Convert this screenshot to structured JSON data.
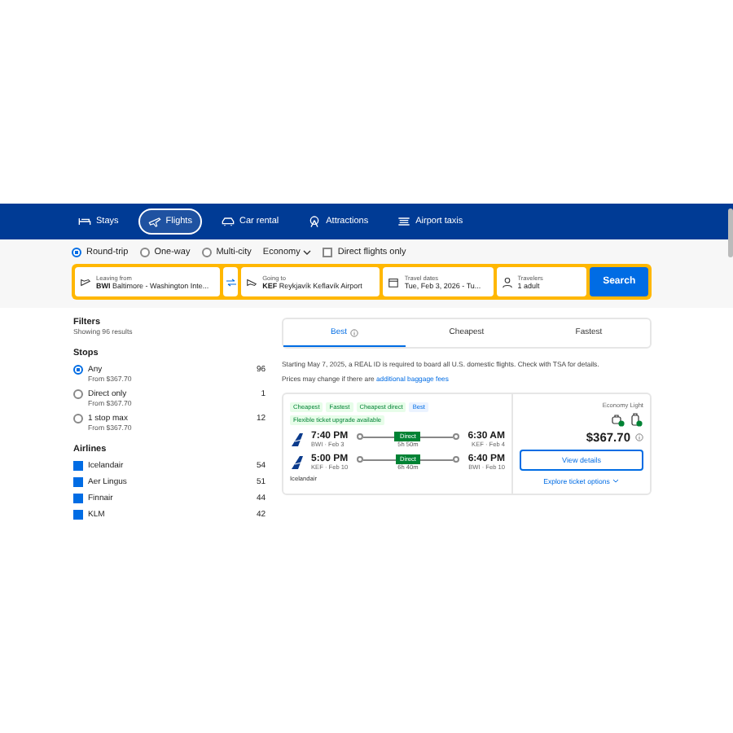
{
  "nav": [
    {
      "label": "Stays",
      "selected": false
    },
    {
      "label": "Flights",
      "selected": true
    },
    {
      "label": "Car rental",
      "selected": false
    },
    {
      "label": "Attractions",
      "selected": false
    },
    {
      "label": "Airport taxis",
      "selected": false
    }
  ],
  "trip_types": [
    {
      "label": "Round-trip",
      "selected": true
    },
    {
      "label": "One-way",
      "selected": false
    },
    {
      "label": "Multi-city",
      "selected": false
    }
  ],
  "cabin": "Economy",
  "direct_only": {
    "label": "Direct flights only",
    "checked": false
  },
  "search": {
    "from": {
      "label": "Leaving from",
      "code": "BWI",
      "value": "Baltimore - Washington Inte..."
    },
    "to": {
      "label": "Going to",
      "code": "KEF",
      "value": "Reykjavík Keflavík Airport"
    },
    "dates": {
      "label": "Travel dates",
      "value": "Tue, Feb 3, 2026 - Tu..."
    },
    "travelers": {
      "label": "Travelers",
      "value": "1 adult"
    },
    "button": "Search"
  },
  "filters": {
    "title": "Filters",
    "count": "Showing 96 results",
    "stops_title": "Stops",
    "stops": [
      {
        "label": "Any",
        "price": "From $367.70",
        "count": "96",
        "selected": true
      },
      {
        "label": "Direct only",
        "price": "From $367.70",
        "count": "1",
        "selected": false
      },
      {
        "label": "1 stop max",
        "price": "From $367.70",
        "count": "12",
        "selected": false
      }
    ],
    "airlines_title": "Airlines",
    "airlines": [
      {
        "label": "Icelandair",
        "count": "54",
        "checked": true
      },
      {
        "label": "Aer Lingus",
        "count": "51",
        "checked": true
      },
      {
        "label": "Finnair",
        "count": "44",
        "checked": true
      },
      {
        "label": "KLM",
        "count": "42",
        "checked": true
      }
    ]
  },
  "sort_tabs": [
    {
      "label": "Best",
      "selected": true
    },
    {
      "label": "Cheapest",
      "selected": false
    },
    {
      "label": "Fastest",
      "selected": false
    }
  ],
  "notice": "Starting May 7, 2025, a REAL ID is required to board all U.S. domestic flights. Check with TSA for details.",
  "price_note": {
    "text": "Prices may change if there are",
    "link": "additional baggage fees"
  },
  "result": {
    "tags": [
      {
        "label": "Cheapest",
        "kind": "green"
      },
      {
        "label": "Fastest",
        "kind": "green"
      },
      {
        "label": "Cheapest direct",
        "kind": "green"
      },
      {
        "label": "Best",
        "kind": "blue"
      }
    ],
    "upgrade": "Flexible ticket upgrade available",
    "legs": [
      {
        "depart": "7:40 PM",
        "depart_info": "BWI · Feb 3",
        "stop": "Direct",
        "duration": "5h 50m",
        "arrive": "6:30 AM",
        "arrive_info": "KEF · Feb 4"
      },
      {
        "depart": "5:00 PM",
        "depart_info": "KEF · Feb 10",
        "stop": "Direct",
        "duration": "6h 40m",
        "arrive": "6:40 PM",
        "arrive_info": "BWI · Feb 10"
      }
    ],
    "airline": "Icelandair",
    "fare": "Economy Light",
    "price": "$367.70",
    "details": "View details",
    "explore": "Explore ticket options"
  }
}
